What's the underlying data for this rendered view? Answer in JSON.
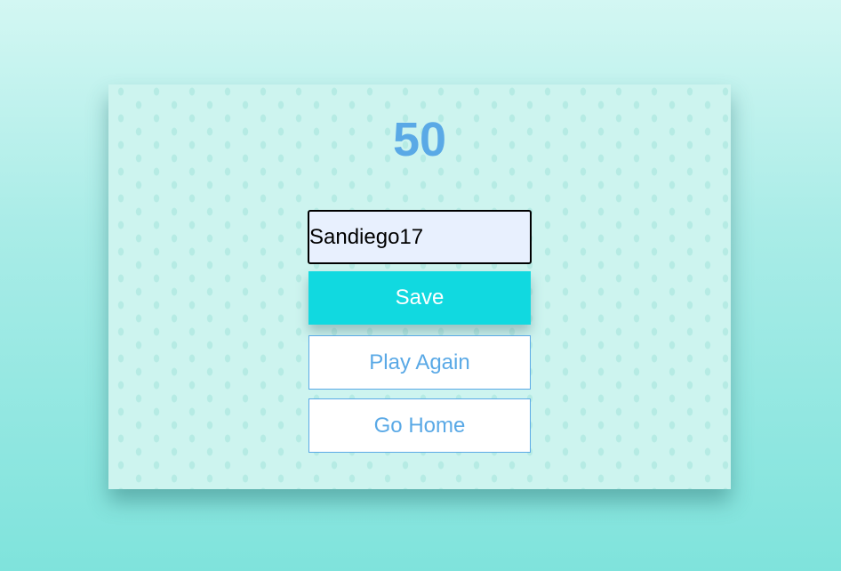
{
  "score": "50",
  "name_input": {
    "value": "Sandiego17"
  },
  "buttons": {
    "save_label": "Save",
    "play_again_label": "Play Again",
    "go_home_label": "Go Home"
  },
  "colors": {
    "score": "#5aa9e6",
    "save_bg": "#11d9e0",
    "outline": "#5aa9e6",
    "card_bg": "#cdf4ef"
  }
}
